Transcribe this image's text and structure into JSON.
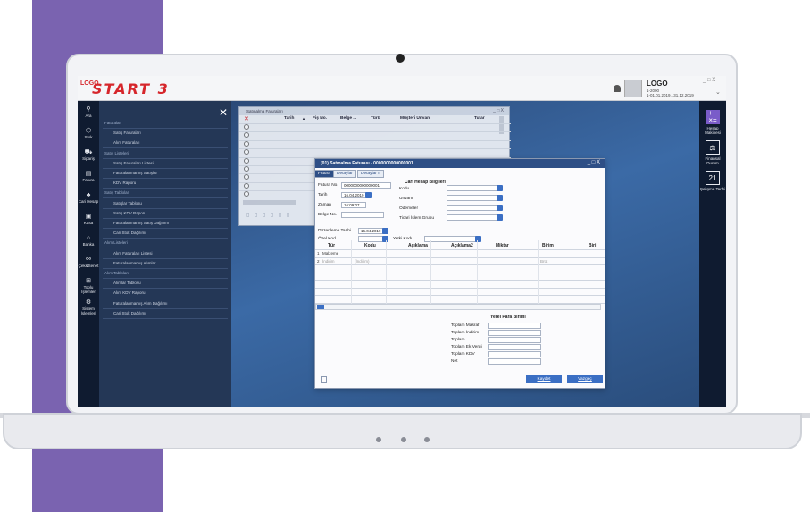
{
  "brand": {
    "logo_sup": "LOGO",
    "logo": "START 3"
  },
  "user": {
    "name": "LOGO",
    "line1": "1-2000",
    "line2": "1-01.01.2019...31.12.2019"
  },
  "top_controls": "_ □ X",
  "left_rail": [
    {
      "label": "Ara",
      "icon": "search-icon",
      "glyph": "⚲"
    },
    {
      "label": "Stok",
      "icon": "box-icon",
      "glyph": "⬡"
    },
    {
      "label": "Sipariş",
      "icon": "cart-icon",
      "glyph": "⛟"
    },
    {
      "label": "Fatura",
      "icon": "invoice-icon",
      "glyph": "▤"
    },
    {
      "label": "Cari Hesap",
      "icon": "users-icon",
      "glyph": "♣"
    },
    {
      "label": "Kasa",
      "icon": "cash-icon",
      "glyph": "▣"
    },
    {
      "label": "Banka",
      "icon": "bank-icon",
      "glyph": "⌂"
    },
    {
      "label": "Çek&Senet",
      "icon": "cheque-icon",
      "glyph": "⚯"
    },
    {
      "label": "Toplu İşlemler",
      "icon": "grid-icon",
      "glyph": "⊞"
    },
    {
      "label": "Sistem İşlemleri",
      "icon": "settings-icon",
      "glyph": "⚙"
    }
  ],
  "menu": {
    "close": "✕",
    "items": [
      {
        "type": "head",
        "label": "Faturalar"
      },
      {
        "type": "sub",
        "label": "Satış Faturaları"
      },
      {
        "type": "sub",
        "label": "Alım Faturaları"
      },
      {
        "type": "head",
        "label": "Satış Listeleri"
      },
      {
        "type": "sub",
        "label": "Satış Faturaları Listesi"
      },
      {
        "type": "sub",
        "label": "Faturalanmamış Satışlar"
      },
      {
        "type": "sub",
        "label": "KDV Raporu"
      },
      {
        "type": "head",
        "label": "Satış Tabloları"
      },
      {
        "type": "sub",
        "label": "Satışlar Tablosu"
      },
      {
        "type": "sub",
        "label": "Satış KDV Raporu"
      },
      {
        "type": "sub",
        "label": "Faturalanmamış Satış Dağılımı"
      },
      {
        "type": "sub",
        "label": "Cari Stok Dağılımı"
      },
      {
        "type": "head",
        "label": "Alım Listeleri"
      },
      {
        "type": "sub",
        "label": "Alım Faturaları Listesi"
      },
      {
        "type": "sub",
        "label": "Faturalanmamış Alımlar"
      },
      {
        "type": "head",
        "label": "Alım Tabloları"
      },
      {
        "type": "sub",
        "label": "Alımlar Tablosu"
      },
      {
        "type": "sub",
        "label": "Alım KDV Raporu"
      },
      {
        "type": "sub",
        "label": "Faturalanmamış Alım Dağılımı"
      },
      {
        "type": "sub",
        "label": "Cari Stok Dağılımı"
      }
    ]
  },
  "right_rail": [
    {
      "label": "Hesap Makinesi",
      "glyph": "+−\n×="
    },
    {
      "label": "Finansal Durum",
      "glyph": "⚖"
    },
    {
      "label": "Çalışma Tarihi",
      "glyph": "21"
    }
  ],
  "list_window": {
    "title": "Satınalma Faturaları",
    "controls": "_ □ X",
    "columns": [
      "Tarih",
      "Fiş No.",
      "Belge ...",
      "Türü",
      "Müşteri Unvanı",
      "Tutar"
    ],
    "footer_icons": "▯ ▯ ▯ ▯ ▯ ▯"
  },
  "invoice_window": {
    "title": "(01) Satınalma Faturası - 0000000000000001",
    "controls": "_ □ X",
    "tabs": [
      "Fatura",
      "Detaylar",
      "Detaylar II"
    ],
    "fields": {
      "fatura_no_label": "Fatura No.",
      "fatura_no": "0000000000000001",
      "tarih_label": "Tarih",
      "tarih": "16.04.2019",
      "zaman_label": "Zaman",
      "zaman": "16:09:07",
      "belge_no_label": "Belge No.",
      "belge_no": "",
      "duzenleme_label": "Düzenleme Tarihi",
      "duzenleme": "16.04.2019",
      "ozel_kod_label": "Özel Kod",
      "ozel_kod": "",
      "yetki_kodu_label": "Yetki Kodu",
      "yetki_kodu": ""
    },
    "cari": {
      "title": "Cari Hesap Bilgileri",
      "kodu": "Kodu",
      "unvani": "Unvanı",
      "odemeler": "Ödemeler",
      "ticari": "Ticari İşlem Grubu"
    },
    "table": {
      "columns": [
        "Tür",
        "Kodu",
        "Açıklama",
        "Açıklama2",
        "Miktar",
        "Birim",
        "Biri"
      ],
      "rows": [
        {
          "no": "1",
          "tur": "Malzeme",
          "kodu": "",
          "aciklama": "",
          "birim": ""
        },
        {
          "no": "2",
          "tur": "İndirim",
          "kodu": "(İndirim)",
          "aciklama": "",
          "birim": "Brüt"
        }
      ]
    },
    "totals": {
      "title": "Yerel Para Birimi",
      "labels": [
        "Toplam Masraf",
        "Toplam İndirim",
        "Toplam",
        "Toplam Ek Vergi",
        "Toplam KDV",
        "Net"
      ]
    },
    "buttons": {
      "save": "Kaydet",
      "cancel": "Vazgeç"
    }
  }
}
